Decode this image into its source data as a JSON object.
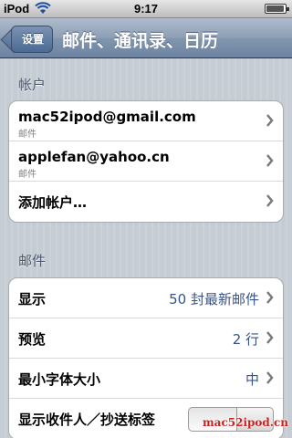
{
  "status": {
    "carrier": "iPod",
    "time": "9:17"
  },
  "nav": {
    "back_label": "设置",
    "title": "邮件、通讯录、日历"
  },
  "accounts": {
    "header": "帐户",
    "items": [
      {
        "title": "mac52ipod@gmail.com",
        "subtitle": "邮件"
      },
      {
        "title": "applefan@yahoo.cn",
        "subtitle": "邮件"
      }
    ],
    "add_label": "添加帐户…"
  },
  "mail": {
    "header": "邮件",
    "rows": [
      {
        "label": "显示",
        "value": "50 封最新邮件"
      },
      {
        "label": "预览",
        "value": "2 行"
      },
      {
        "label": "最小字体大小",
        "value": "中"
      }
    ],
    "show_to_cc_label": "显示收件人／抄送标签"
  },
  "watermark": "mac52ipod.cn",
  "colors": {
    "value_blue": "#385487",
    "nav_blue": "#6d83a1"
  }
}
